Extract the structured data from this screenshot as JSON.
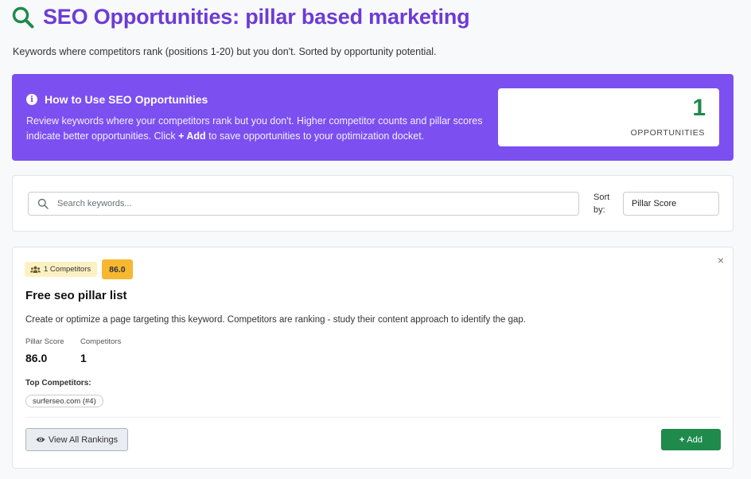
{
  "header": {
    "title": "SEO Opportunities: pillar based marketing",
    "subtitle": "Keywords where competitors rank (positions 1-20) but you don't. Sorted by opportunity potential.",
    "icon": "search-icon",
    "title_color": "#6d3bd6"
  },
  "banner": {
    "title": "How to Use SEO Opportunities",
    "text_before": "Review keywords where your competitors rank but you don't. Higher competitor counts and pillar scores indicate better opportunities. Click ",
    "text_bold": "+ Add",
    "text_after": " to save opportunities to your optimization docket.",
    "background": "#7c4ff0",
    "opportunities_count": "1",
    "opportunities_label": "OPPORTUNITIES"
  },
  "search": {
    "placeholder": "Search keywords...",
    "value": "",
    "sort_label": "Sort by:",
    "sort_value": "Pillar Score"
  },
  "results": [
    {
      "competitors_badge": "1 Competitors",
      "score_badge": "86.0",
      "keyword": "Free seo pillar list",
      "description": "Create or optimize a page targeting this keyword. Competitors are ranking - study their content approach to identify the gap.",
      "metrics": [
        {
          "label": "Pillar Score",
          "value": "86.0"
        },
        {
          "label": "Competitors",
          "value": "1"
        }
      ],
      "top_competitors_label": "Top Competitors:",
      "top_competitors": [
        "surferseo.com (#4)"
      ],
      "view_button": "View All Rankings",
      "add_button": "Add",
      "close_symbol": "×"
    }
  ],
  "colors": {
    "accent_green": "#1e8a4c",
    "score_badge": "#f7b731",
    "competitor_badge": "#fdf1c4"
  }
}
